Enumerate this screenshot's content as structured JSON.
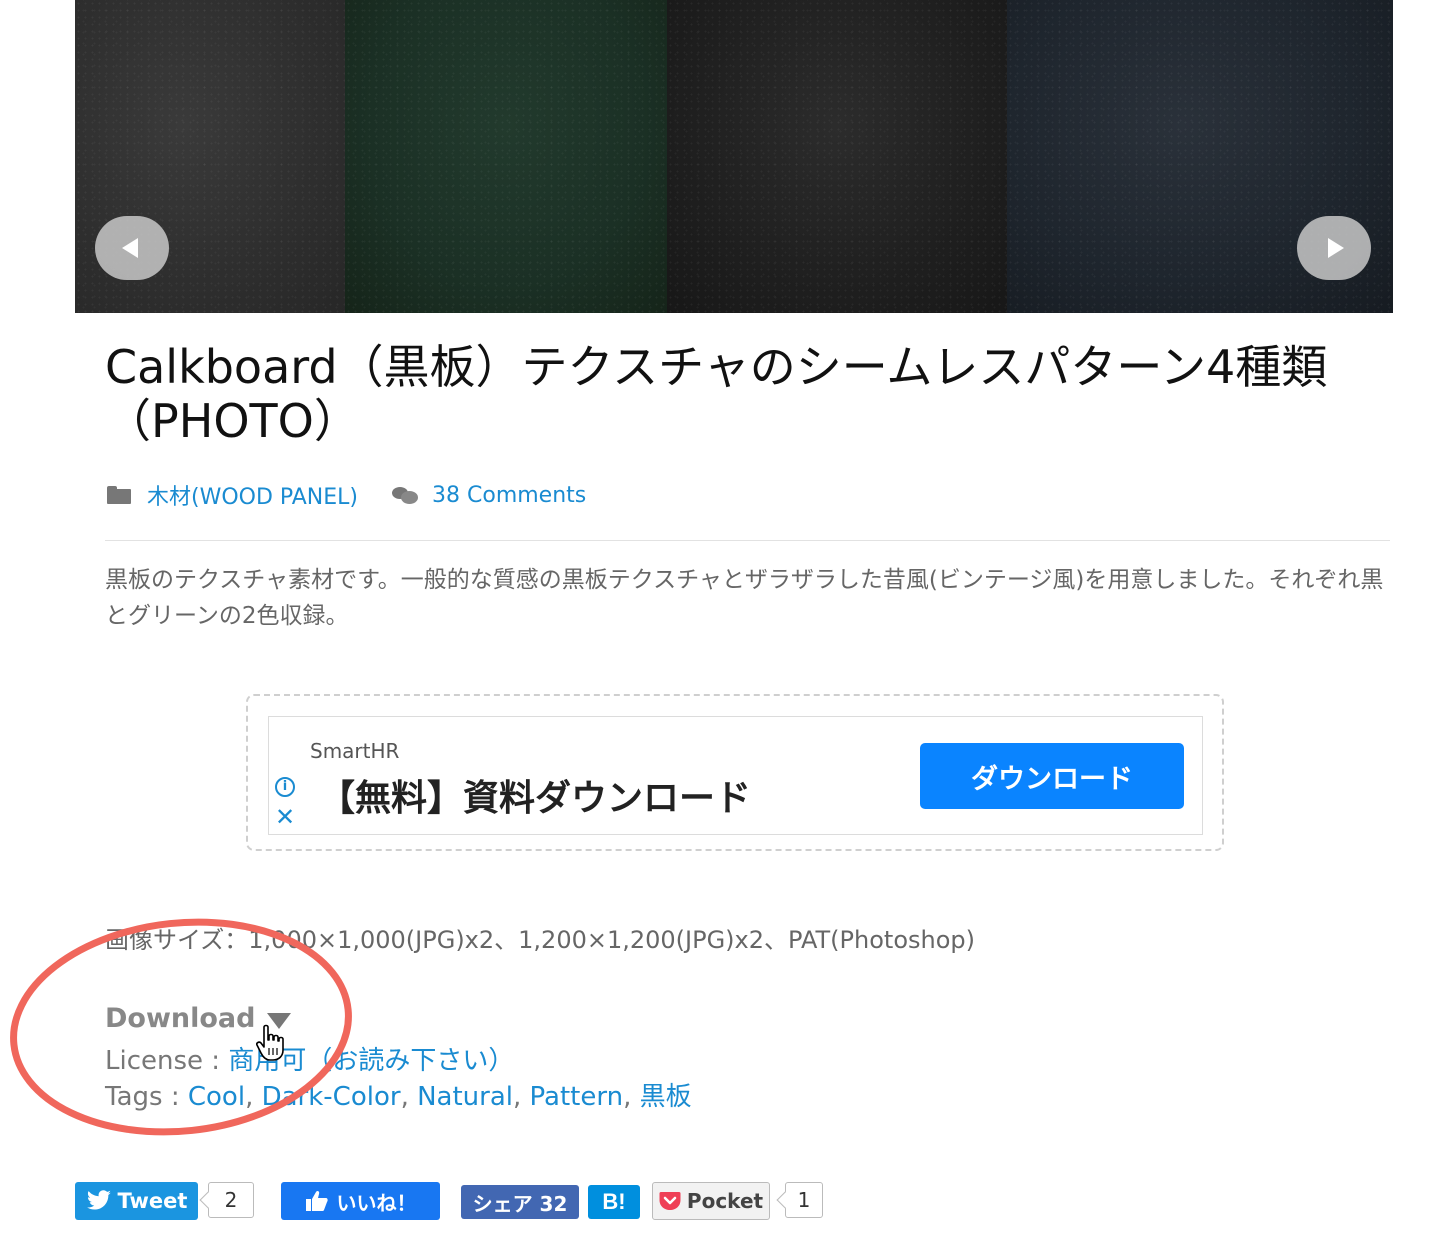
{
  "slider": {
    "prev_label": "previous-slide",
    "next_label": "next-slide"
  },
  "post": {
    "title_line1": "Calkboard（黒板）テクスチャのシームレスパターン4種類",
    "title_line2": "（PHOTO）",
    "category": "木材(WOOD PANEL)",
    "comments": "38 Comments",
    "description": "黒板のテクスチャ素材です。一般的な質感の黒板テクスチャとザラザラした昔風(ビンテージ風)を用意しました。それぞれ黒とグリーンの2色収録。"
  },
  "ad": {
    "brand": "SmartHR",
    "headline": "【無料】資料ダウンロード",
    "cta": "ダウンロード",
    "info_icon": "i",
    "close_icon": "✕"
  },
  "details": {
    "image_size": "画像サイズ：1,000×1,000(JPG)x2、1,200×1,200(JPG)x2、PAT(Photoshop)",
    "download_label": "Download",
    "license_prefix": "License : ",
    "license_link": "商用可（お読み下さい）",
    "tags_prefix": "Tags : ",
    "tags": [
      "Cool",
      "Dark-Color",
      "Natural",
      "Pattern",
      "黒板"
    ],
    "separator": ", "
  },
  "social": {
    "tweet_label": "Tweet",
    "tweet_count": "2",
    "fb_label": "いいね！",
    "share_label": "シェア 32",
    "hatena_label": "B!",
    "pocket_label": "Pocket",
    "pocket_count": "1"
  },
  "colors": {
    "link": "#1a8bd1",
    "annotation": "#f0675c",
    "twitter": "#1b95e0",
    "facebook": "#1877f2",
    "ad_cta": "#0a84ff"
  }
}
